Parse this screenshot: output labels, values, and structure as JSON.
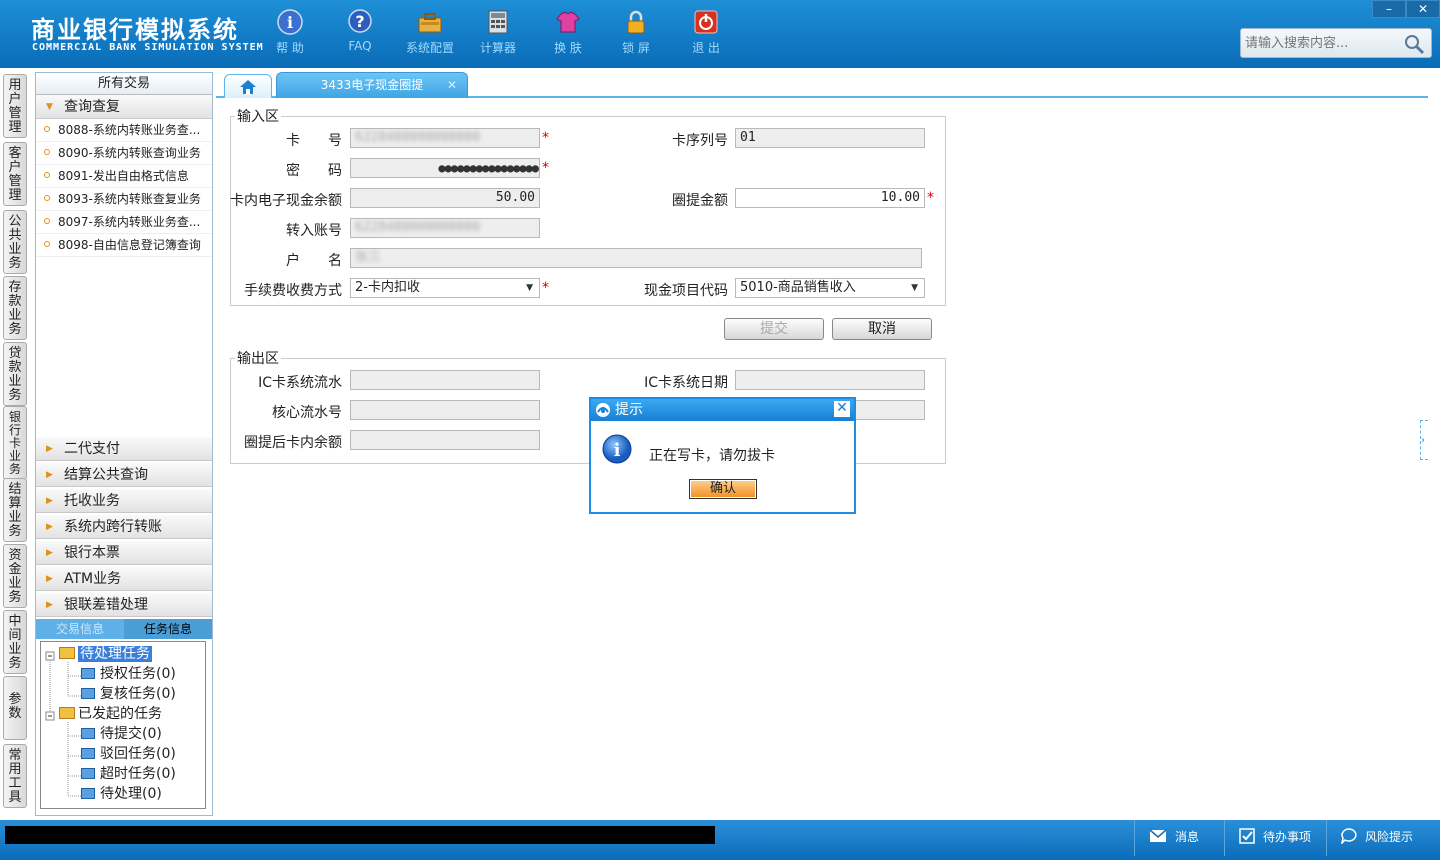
{
  "header": {
    "logo_cn": "商业银行模拟系统",
    "logo_en": "COMMERCIAL BANK SIMULATION SYSTEM",
    "toolbar": [
      {
        "label": "帮 助",
        "icon": "info-icon"
      },
      {
        "label": "FAQ",
        "icon": "faq-icon"
      },
      {
        "label": "系统配置",
        "icon": "toolbox-icon"
      },
      {
        "label": "计算器",
        "icon": "calculator-icon"
      },
      {
        "label": "换 肤",
        "icon": "shirt-icon"
      },
      {
        "label": "锁 屏",
        "icon": "lock-icon"
      },
      {
        "label": "退 出",
        "icon": "power-icon"
      }
    ],
    "search_placeholder": "请输入搜索内容...",
    "window_minimize": "–",
    "window_close": "✕"
  },
  "side_tabs": [
    "用户管理",
    "客户管理",
    "公共业务",
    "存款业务",
    "贷款业务",
    "银行卡业务",
    "结算业务",
    "资金业务",
    "中间业务",
    "参数",
    "常用工具"
  ],
  "left_panel": {
    "title": "所有交易",
    "open_section": "查询查复",
    "open_items": [
      "8088-系统内转账业务查...",
      "8090-系统内转账查询业务",
      "8091-发出自由格式信息",
      "8093-系统内转账查复业务",
      "8097-系统内转账业务查...",
      "8098-自由信息登记簿查询"
    ],
    "sections": [
      "二代支付",
      "结算公共查询",
      "托收业务",
      "系统内跨行转账",
      "银行本票",
      "ATM业务",
      "银联差错处理"
    ],
    "info_tabs": [
      "交易信息",
      "任务信息"
    ],
    "tree": {
      "pending": "待处理任务",
      "pending_children": [
        "授权任务(0)",
        "复核任务(0)"
      ],
      "initiated": "已发起的任务",
      "initiated_children": [
        "待提交(0)",
        "驳回任务(0)",
        "超时任务(0)",
        "待处理(0)"
      ]
    }
  },
  "tabs": {
    "home_icon": "home-icon",
    "active_tab": "3433电子现金圈提",
    "close": "✕"
  },
  "form": {
    "input_legend": "输入区",
    "card_no_label": "卡　　号",
    "card_no_value": "6228480000000000",
    "card_seq_label": "卡序列号",
    "card_seq_value": "01",
    "password_label": "密　　码",
    "password_value": "●●●●●●●●●●●●●●●●",
    "balance_label": "卡内电子现金余额",
    "balance_value": "50.00",
    "amount_label": "圈提金额",
    "amount_value": "10.00",
    "to_account_label": "转入账号",
    "to_account_value": "6228480000000000",
    "name_label": "户　　名",
    "name_value": "张三",
    "fee_label": "手续费收费方式",
    "fee_value": "2-卡内扣收",
    "cash_code_label": "现金项目代码",
    "cash_code_value": "5010-商品销售收入",
    "submit": "提交",
    "cancel": "取消",
    "required_mark": "*",
    "output_legend": "输出区",
    "ic_serial_label": "IC卡系统流水",
    "ic_date_label": "IC卡系统日期",
    "core_serial_label": "核心流水号",
    "after_balance_label": "圈提后卡内余额"
  },
  "dialog": {
    "title": "提示",
    "message": "正在写卡，请勿拔卡",
    "ok": "确认",
    "close": "✕"
  },
  "status_bar": {
    "messages": "消息",
    "todo": "待办事项",
    "risk": "风险提示"
  },
  "colors": {
    "header_blue": "#0a6cb8",
    "accent_blue": "#1c8de3",
    "required_red": "#dd0000",
    "ok_orange": "#f5a032"
  }
}
